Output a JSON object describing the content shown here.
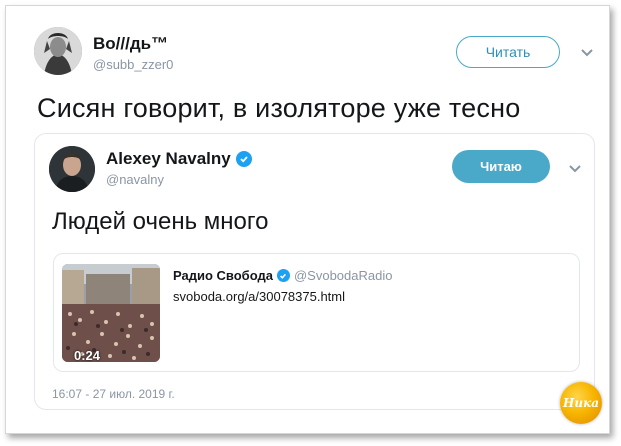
{
  "tweet": {
    "author_name": "Во///дь™",
    "author_handle": "@subb_zzer0",
    "follow_label": "Читать",
    "text": "Сисян говорит, в изоляторе уже тесно"
  },
  "quoted": {
    "author_name": "Alexey Navalny",
    "author_handle": "@navalny",
    "follow_label": "Читаю",
    "text": "Людей очень много",
    "timestamp": "16:07 - 27 июл. 2019 г.",
    "card": {
      "source_name": "Радио Свобода",
      "source_handle": "@SvobodaRadio",
      "url": "svoboda.org/a/30078375.html",
      "video_duration": "0:24"
    }
  },
  "watermark": {
    "text": "Ника"
  },
  "colors": {
    "accent": "#4aa8c9",
    "verified": "#1da1f2",
    "muted": "#8a96a3"
  }
}
